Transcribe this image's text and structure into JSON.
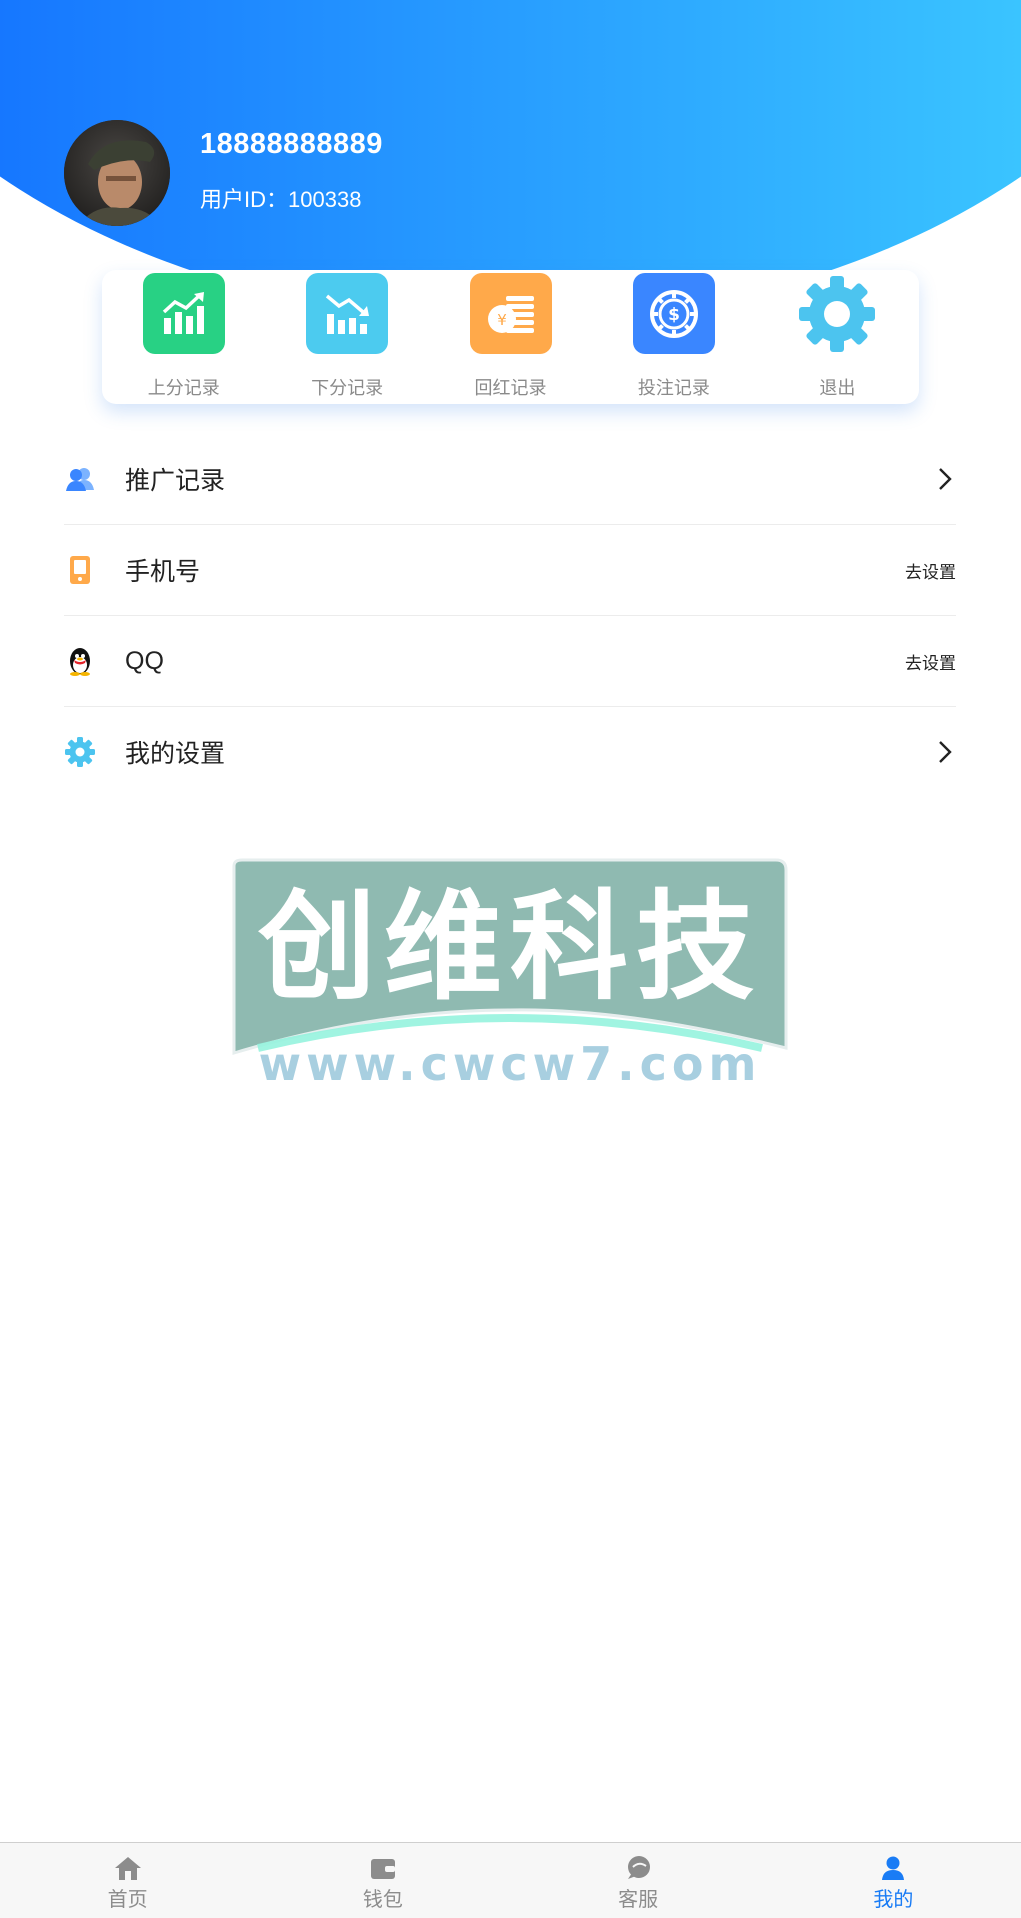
{
  "profile": {
    "phone": "18888888889",
    "uid_label": "用户ID：",
    "uid_value": "100338"
  },
  "quick_actions": [
    {
      "label": "上分记录",
      "icon": "trend-up-chart-icon",
      "color": "#28d184"
    },
    {
      "label": "下分记录",
      "icon": "trend-down-chart-icon",
      "color": "#4ccbef"
    },
    {
      "label": "回红记录",
      "icon": "coins-yen-icon",
      "color": "#ffa94a"
    },
    {
      "label": "投注记录",
      "icon": "dollar-chip-icon",
      "color": "#3a86ff"
    },
    {
      "label": "退出",
      "icon": "gear-icon",
      "color": "#4cc4ef"
    }
  ],
  "menu": [
    {
      "label": "推广记录",
      "icon": "users-icon",
      "action": "",
      "icon_color": "#3a86ff"
    },
    {
      "label": "手机号",
      "icon": "mobile-phone-icon",
      "action": "去设置",
      "icon_color": "#ffa94a"
    },
    {
      "label": "QQ",
      "icon": "qq-penguin-icon",
      "action": "去设置",
      "icon_color": "#111111"
    },
    {
      "label": "我的设置",
      "icon": "gear-icon",
      "action": "",
      "icon_color": "#4cc4ef"
    }
  ],
  "watermark": {
    "title": "创维科技",
    "url": "www.cwcw7.com"
  },
  "bottom_nav": [
    {
      "label": "首页",
      "icon": "home-icon"
    },
    {
      "label": "钱包",
      "icon": "wallet-icon"
    },
    {
      "label": "客服",
      "icon": "chat-bubble-icon"
    },
    {
      "label": "我的",
      "icon": "person-icon",
      "active": true
    }
  ],
  "colors": {
    "header_start": "#1677ff",
    "header_end": "#3ac4ff",
    "active_tab": "#1a7cf5"
  }
}
